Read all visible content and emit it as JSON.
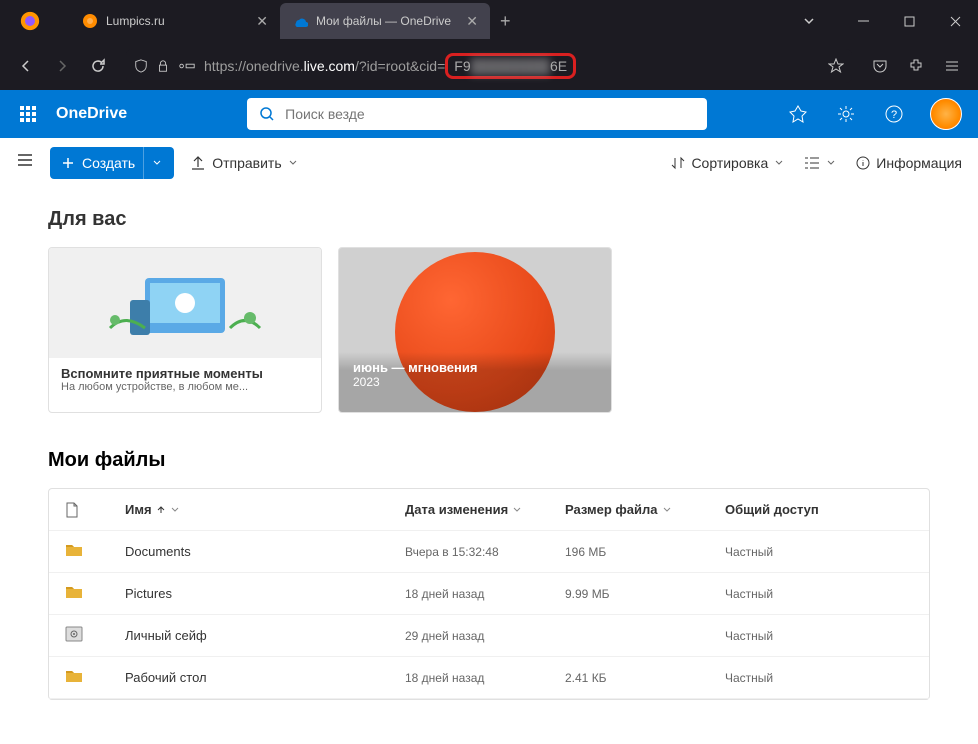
{
  "browser": {
    "tabs": [
      {
        "title": "Lumpics.ru",
        "active": false
      },
      {
        "title": "Мои файлы — OneDrive",
        "active": true
      }
    ],
    "url_pre": "https://onedrive.",
    "url_host": "live.com",
    "url_post": "/?id=root&cid=",
    "url_cid_start": "F9",
    "url_cid_end": "6E"
  },
  "header": {
    "brand": "OneDrive",
    "search_placeholder": "Поиск везде"
  },
  "cmdbar": {
    "create": "Создать",
    "upload": "Отправить",
    "sort": "Сортировка",
    "info": "Информация"
  },
  "foryou": {
    "title": "Для вас",
    "card1_title": "Вспомните приятные моменты",
    "card1_sub": "На любом устройстве, в любом ме...",
    "card2_title": "июнь — мгновения",
    "card2_sub": "2023"
  },
  "files": {
    "title": "Мои файлы",
    "cols": {
      "name": "Имя",
      "modified": "Дата изменения",
      "size": "Размер файла",
      "sharing": "Общий доступ"
    },
    "rows": [
      {
        "name": "Documents",
        "type": "folder",
        "modified": "Вчера в 15:32:48",
        "size": "196 МБ",
        "sharing": "Частный"
      },
      {
        "name": "Pictures",
        "type": "folder",
        "modified": "18 дней назад",
        "size": "9.99 МБ",
        "sharing": "Частный"
      },
      {
        "name": "Личный сейф",
        "type": "vault",
        "modified": "29 дней назад",
        "size": "",
        "sharing": "Частный"
      },
      {
        "name": "Рабочий стол",
        "type": "folder",
        "modified": "18 дней назад",
        "size": "2.41 КБ",
        "sharing": "Частный"
      }
    ]
  }
}
